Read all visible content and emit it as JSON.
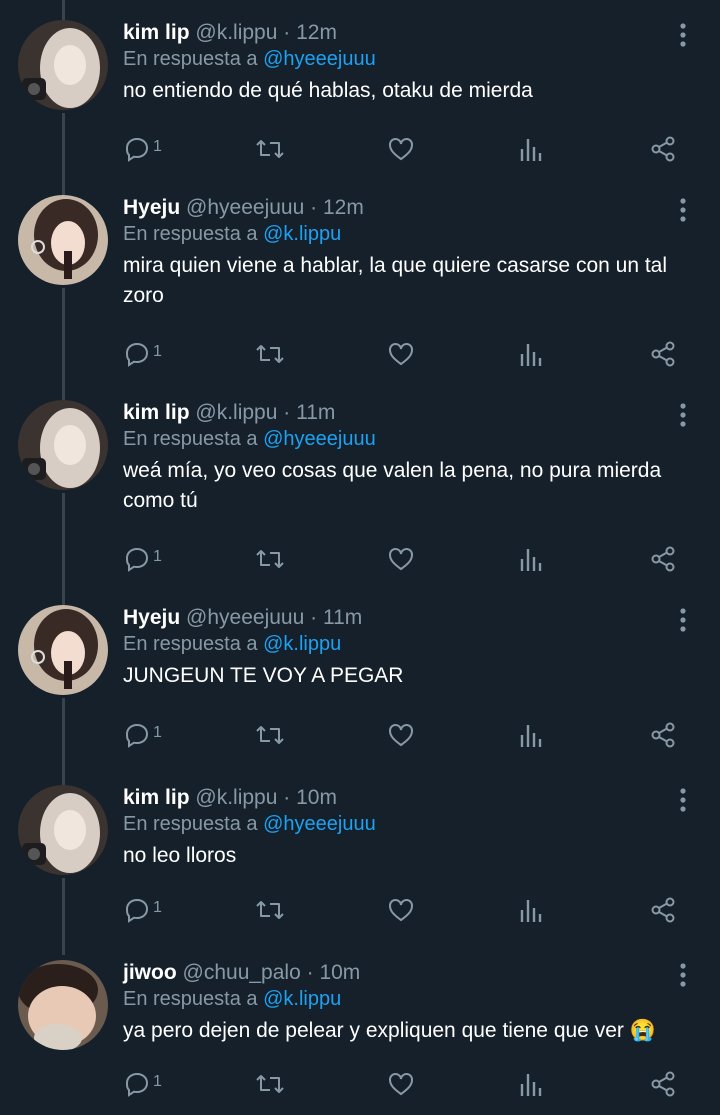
{
  "reply_prefix": "En respuesta a",
  "colors": {
    "background": "#15202b",
    "secondary": "#8899a6",
    "mention": "#1da1f2",
    "thread_line": "#38444d"
  },
  "tweets": [
    {
      "name": "kim lip",
      "handle": "@k.lippu",
      "sep": "·",
      "time": "12m",
      "reply_to": "@hyeeejuuu",
      "text": "no entiendo de qué hablas, otaku de mierda",
      "reply_count": "1",
      "avatar": "avatar-kimlip"
    },
    {
      "name": "Hyeju",
      "handle": "@hyeeejuuu",
      "sep": "·",
      "time": "12m",
      "reply_to": "@k.lippu",
      "text": "mira quien viene a hablar, la que quiere casarse con un tal zoro",
      "reply_count": "1",
      "avatar": "avatar-hyeju"
    },
    {
      "name": "kim lip",
      "handle": "@k.lippu",
      "sep": "·",
      "time": "11m",
      "reply_to": "@hyeeejuuu",
      "text": "weá mía, yo veo cosas que valen la pena, no pura mierda como tú",
      "reply_count": "1",
      "avatar": "avatar-kimlip"
    },
    {
      "name": "Hyeju",
      "handle": "@hyeeejuuu",
      "sep": "·",
      "time": "11m",
      "reply_to": "@k.lippu",
      "text": "JUNGEUN TE VOY A PEGAR",
      "reply_count": "1",
      "avatar": "avatar-hyeju"
    },
    {
      "name": "kim lip",
      "handle": "@k.lippu",
      "sep": "·",
      "time": "10m",
      "reply_to": "@hyeeejuuu",
      "text": "no leo lloros",
      "reply_count": "1",
      "avatar": "avatar-kimlip"
    },
    {
      "name": "jiwoo",
      "handle": "@chuu_palo",
      "sep": "·",
      "time": "10m",
      "reply_to": "@k.lippu",
      "text": "ya pero dejen de pelear y expliquen que tiene que ver 😭",
      "reply_count": "1",
      "avatar": "avatar-jiwoo"
    }
  ],
  "icons": {
    "reply": "reply-icon",
    "retweet": "retweet-icon",
    "like": "heart-icon",
    "stats": "bar-chart-icon",
    "share": "share-icon",
    "more": "more-vertical-icon"
  }
}
